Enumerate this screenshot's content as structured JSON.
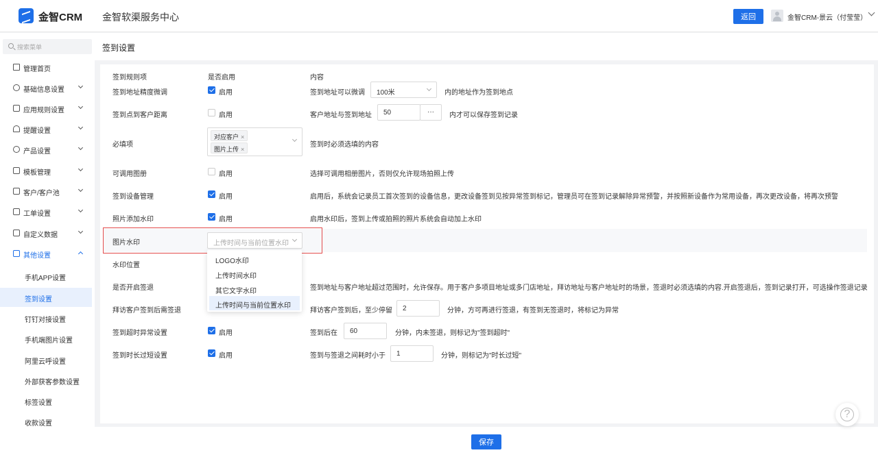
{
  "header": {
    "brand": "金智CRM",
    "center_title": "金智软渠服务中心",
    "back_label": "返回",
    "user_name": "金智CRM-景云（付莹莹）"
  },
  "sidebar": {
    "search_placeholder": "搜索菜单",
    "items": [
      {
        "label": "管理首页",
        "icon": "home-icon"
      },
      {
        "label": "基础信息设置",
        "icon": "cube-icon"
      },
      {
        "label": "应用规则设置",
        "icon": "document-icon"
      },
      {
        "label": "提醒设置",
        "icon": "bell-icon"
      },
      {
        "label": "产品设置",
        "icon": "box-icon"
      },
      {
        "label": "模板管理",
        "icon": "template-icon"
      },
      {
        "label": "客户/客户池",
        "icon": "customer-icon"
      },
      {
        "label": "工单设置",
        "icon": "ticket-icon"
      },
      {
        "label": "自定义数据",
        "icon": "data-icon"
      },
      {
        "label": "其他设置",
        "icon": "grid-icon"
      }
    ],
    "sub_items": [
      "手机APP设置",
      "签到设置",
      "钉钉对接设置",
      "手机端图片设置",
      "阿里云呼设置",
      "外部获客参数设置",
      "标签设置",
      "收款设置"
    ],
    "active_sub": "签到设置"
  },
  "page": {
    "title": "签到设置",
    "headers": {
      "rule": "签到规则项",
      "enabled": "是否启用",
      "content": "内容"
    },
    "enable_label": "启用",
    "rows": {
      "r1": {
        "label": "签到地址精度微调",
        "pre": "签到地址可以微调",
        "select": "100米",
        "post": "内的地址作为签到地点"
      },
      "r2": {
        "label": "签到点到客户距离",
        "pre": "客户地址与签到地址",
        "value": "50",
        "more": "···",
        "post": "内才可以保存签到记录"
      },
      "r3": {
        "label": "必填项",
        "tag1": "对应客户",
        "tag2": "图片上传",
        "x": "×",
        "content": "签到时必须选填的内容"
      },
      "r4": {
        "label": "可调用图册",
        "content": "选择可调用相册图片，否则仅允许现场拍照上传"
      },
      "r5": {
        "label": "签到设备管理",
        "content": "启用后，系统会记录员工首次签到的设备信息，更改设备签到见按异常签到标记，管理员可在签到记录解除异常预警，并按照新设备作为常用设备，再次更改设备，将再次预警"
      },
      "r6": {
        "label": "照片添加水印",
        "content": "启用水印后，签到上传或拍照的照片系统会自动加上水印"
      },
      "r7": {
        "label": "图片水印",
        "select": "上传时间与当前位置水印"
      },
      "r8": {
        "label": "水印位置"
      },
      "r9": {
        "label": "是否开启签退",
        "content": "签到地址与客户地址超过范围时，允许保存。用于客户多项目地址或多门店地址，拜访地址与客户地址时的场景，签退时必须选填的内容.开启签退后，签到记录打开，可选操作签退记录"
      },
      "r10": {
        "label": "拜访客户签到后需签退",
        "pre": "拜访客户签到后，至少停留",
        "value": "2",
        "post": "分钟，方可再进行签退，有签到无签退时，将标记为异常"
      },
      "r11": {
        "label": "签到超时异常设置",
        "pre": "签到后在",
        "value": "60",
        "post": "分钟，内未签退，则标记为\"签到超时\""
      },
      "r12": {
        "label": "签到时长过短设置",
        "pre": "签到与签退之间耗时小于",
        "value": "1",
        "post": "分钟，则标记为\"时长过短\""
      }
    },
    "dropdown_options": [
      "LOGO水印",
      "上传时间水印",
      "其它文字水印",
      "上传时间与当前位置水印"
    ],
    "save_label": "保存",
    "help_label": "?"
  }
}
